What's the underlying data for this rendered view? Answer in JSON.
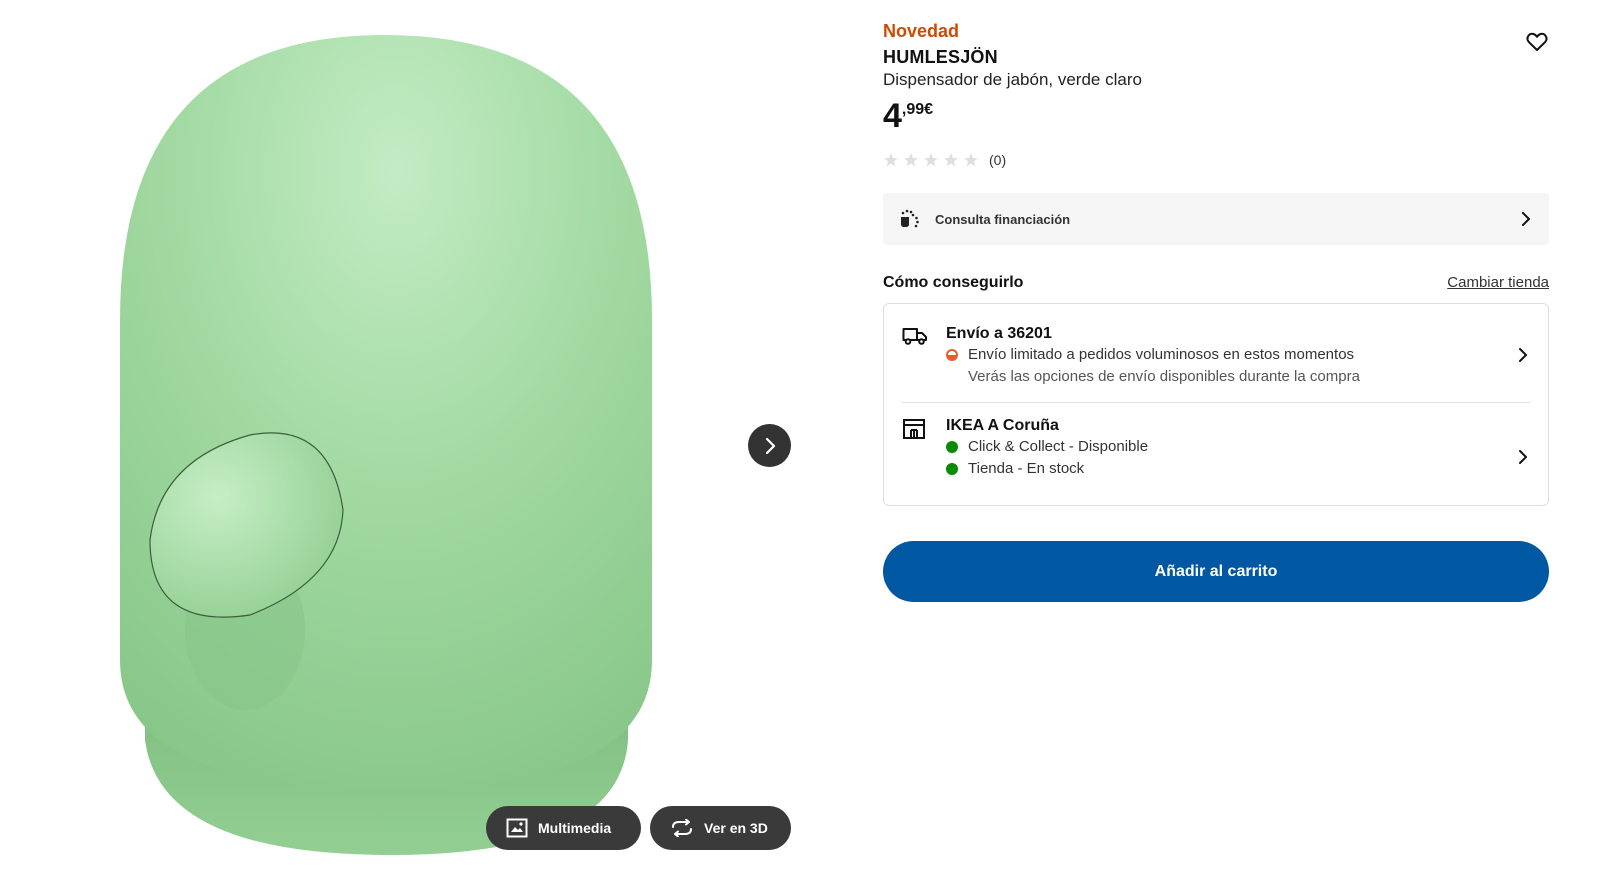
{
  "media": {
    "next_label": "Siguiente imagen",
    "multimedia_label": "Multimedia",
    "view3d_label": "Ver en 3D"
  },
  "product": {
    "badge": "Novedad",
    "name": "HUMLESJÖN",
    "description": "Dispensador de jabón, verde claro",
    "price_integer": "4",
    "price_decimal": ",99",
    "price_currency": "€",
    "rating_count": "(0)",
    "rating_stars_filled": 0,
    "rating_stars_total": 5,
    "color": "#8fd18f"
  },
  "finance": {
    "label": "Consulta financiación"
  },
  "fulfilment": {
    "title": "Cómo conseguirlo",
    "change_store": "Cambiar tienda",
    "delivery": {
      "title": "Envío a 36201",
      "status": "Envío limitado a pedidos voluminosos en estos momentos",
      "note": "Verás las opciones de envío disponibles durante la compra"
    },
    "store": {
      "title": "IKEA A Coruña",
      "click_collect": "Click & Collect - Disponible",
      "in_store": "Tienda - En stock"
    }
  },
  "cart": {
    "label": "Añadir al carrito"
  },
  "colors": {
    "brand_blue": "#0058a3",
    "new_orange": "#cc4b00",
    "available_green": "#0a8a00",
    "limited_orange": "#e85d2c"
  }
}
